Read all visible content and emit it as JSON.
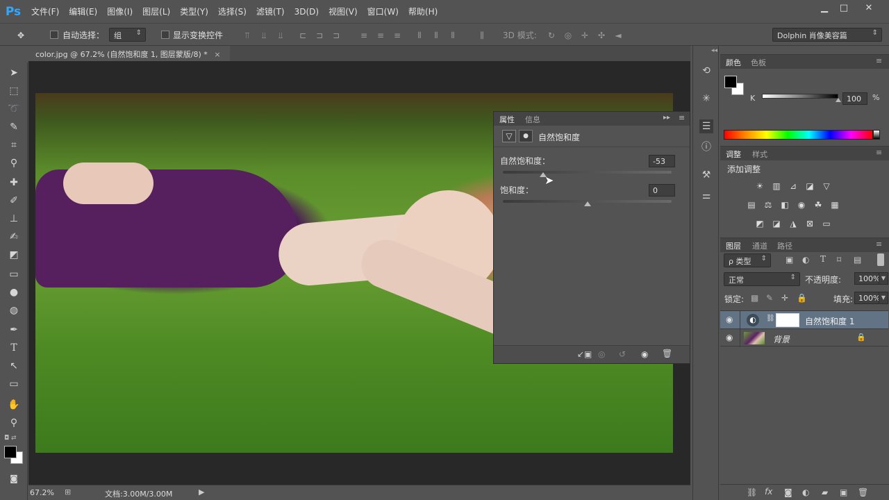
{
  "app": {
    "logo": "Ps"
  },
  "menu": [
    "文件(F)",
    "编辑(E)",
    "图像(I)",
    "图层(L)",
    "类型(Y)",
    "选择(S)",
    "滤镜(T)",
    "3D(D)",
    "视图(V)",
    "窗口(W)",
    "帮助(H)"
  ],
  "window_controls": {
    "minimize": "▁",
    "maximize": "□",
    "close": "✕"
  },
  "options": {
    "auto_select_label": "自动选择：",
    "auto_select_value": "组",
    "show_transform_label": "显示变换控件",
    "mode_3d_label": "3D 模式:",
    "workspace": "Dolphin 肖像美容篇"
  },
  "document": {
    "tab_title": "color.jpg @ 67.2% (自然饱和度 1, 图层蒙版/8) *",
    "close_glyph": "×"
  },
  "status": {
    "zoom": "67.2%",
    "doc_size": "文档:3.00M/3.00M"
  },
  "properties": {
    "tabs": [
      "属性",
      "信息"
    ],
    "adjustment_title": "自然饱和度",
    "vibrance_label": "自然饱和度：",
    "vibrance_value": "-53",
    "vibrance_fraction": 0.24,
    "saturation_label": "饱和度：",
    "saturation_value": "0",
    "saturation_fraction": 0.5
  },
  "color_panel": {
    "tabs": [
      "颜色",
      "色板"
    ],
    "channel": "K",
    "value": "100",
    "unit": "%",
    "foreground": "#000000",
    "background": "#ffffff"
  },
  "adjustments_panel": {
    "tabs": [
      "调整",
      "样式"
    ],
    "title": "添加调整"
  },
  "layers_panel": {
    "tabs": [
      "图层",
      "通道",
      "路径"
    ],
    "filter": "ρ 类型",
    "blend_mode": "正常",
    "opacity_label": "不透明度:",
    "opacity_value": "100%",
    "lock_label": "锁定:",
    "fill_label": "填充:",
    "fill_value": "100%",
    "layers": [
      {
        "name": "自然饱和度 1",
        "selected": true
      },
      {
        "name": "背景",
        "selected": false
      }
    ]
  }
}
